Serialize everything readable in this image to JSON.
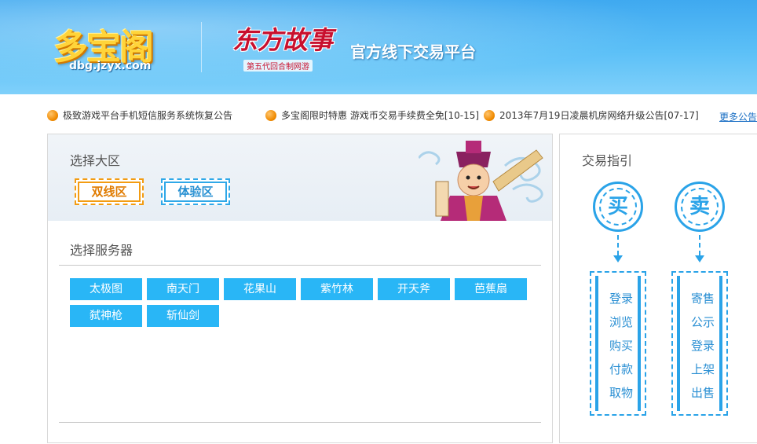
{
  "banner": {
    "logo_text": "多宝阁",
    "logo_url": "dbg.jzyx.com",
    "game_logo_text": "东方故事",
    "game_logo_sub": "第五代回合制网游",
    "platform_title": "官方线下交易平台"
  },
  "notices": [
    {
      "text": "极致游戏平台手机短信服务系统恢复公告"
    },
    {
      "text": "多宝阁限时特惠 游戏币交易手续费全免[10-15]"
    },
    {
      "text": "2013年7月19日凌晨机房网络升级公告[07-17]"
    }
  ],
  "more_link": "更多公告",
  "region": {
    "label": "选择大区",
    "options": [
      "双线区",
      "体验区"
    ],
    "selected": "双线区"
  },
  "server": {
    "label": "选择服务器",
    "options": [
      "太极图",
      "南天门",
      "花果山",
      "紫竹林",
      "开天斧",
      "芭蕉扇",
      "弑神枪",
      "斩仙剑"
    ]
  },
  "guide": {
    "title": "交易指引",
    "buy": {
      "label": "买",
      "steps": [
        "登录",
        "浏览",
        "购买",
        "付款",
        "取物"
      ]
    },
    "sell": {
      "label": "卖",
      "steps": [
        "寄售",
        "公示",
        "登录",
        "上架",
        "出售"
      ]
    }
  },
  "colors": {
    "banner_blue": "#3fa9f0",
    "accent_orange": "#f39c12",
    "server_button": "#29b6f6",
    "guide_blue": "#2aa3e8"
  }
}
